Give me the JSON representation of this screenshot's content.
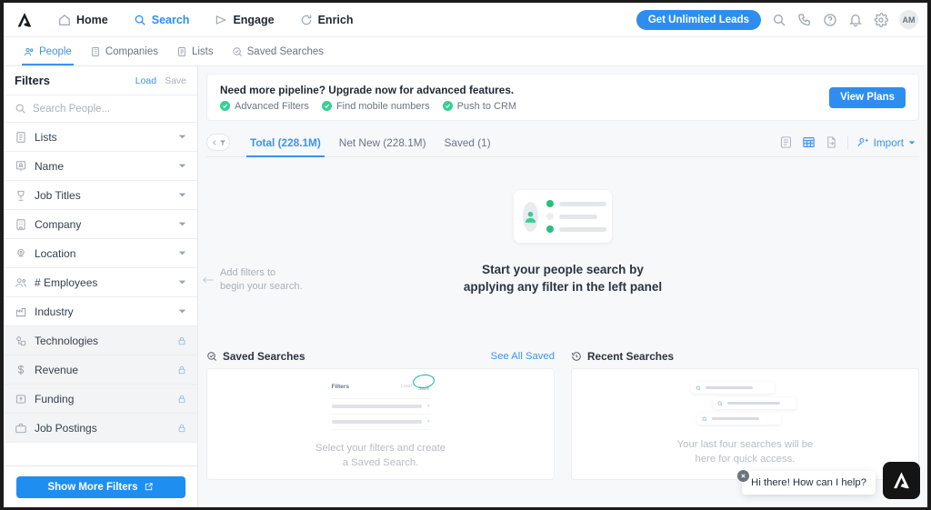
{
  "topnav": {
    "logo_name": "apollo-logo",
    "items": [
      {
        "label": "Home",
        "icon": "home-icon",
        "active": false
      },
      {
        "label": "Search",
        "icon": "search-icon",
        "active": true
      },
      {
        "label": "Engage",
        "icon": "send-icon",
        "active": false
      },
      {
        "label": "Enrich",
        "icon": "refresh-icon",
        "active": false
      }
    ],
    "cta_label": "Get Unlimited Leads",
    "icons": [
      "search-icon",
      "phone-icon",
      "help-circle-icon",
      "bell-icon",
      "gear-icon"
    ],
    "avatar_initials": "AM"
  },
  "subnav": {
    "items": [
      {
        "label": "People",
        "icon": "people-icon",
        "active": true
      },
      {
        "label": "Companies",
        "icon": "building-icon",
        "active": false
      },
      {
        "label": "Lists",
        "icon": "list-icon",
        "active": false
      },
      {
        "label": "Saved Searches",
        "icon": "saved-search-icon",
        "active": false
      }
    ]
  },
  "sidebar": {
    "title": "Filters",
    "load_label": "Load",
    "save_label": "Save",
    "search_placeholder": "Search People...",
    "filters": [
      {
        "label": "Lists",
        "icon": "list-icon",
        "locked": false
      },
      {
        "label": "Name",
        "icon": "badge-icon",
        "locked": false
      },
      {
        "label": "Job Titles",
        "icon": "job-icon",
        "locked": false
      },
      {
        "label": "Company",
        "icon": "building-icon",
        "locked": false
      },
      {
        "label": "Location",
        "icon": "pin-icon",
        "locked": false
      },
      {
        "label": "# Employees",
        "icon": "people-icon",
        "locked": false
      },
      {
        "label": "Industry",
        "icon": "industry-icon",
        "locked": false
      },
      {
        "label": "Technologies",
        "icon": "tech-icon",
        "locked": true
      },
      {
        "label": "Revenue",
        "icon": "dollar-icon",
        "locked": true
      },
      {
        "label": "Funding",
        "icon": "funding-icon",
        "locked": true
      },
      {
        "label": "Job Postings",
        "icon": "briefcase-icon",
        "locked": true
      }
    ],
    "show_more_label": "Show More Filters"
  },
  "banner": {
    "title": "Need more pipeline? Upgrade now for advanced features.",
    "features": [
      "Advanced Filters",
      "Find mobile numbers",
      "Push to CRM"
    ],
    "button_label": "View Plans"
  },
  "tabsbar": {
    "collapse_icon": "collapse-filter-icon",
    "tabs": [
      {
        "label": "Total (228.1M)",
        "active": true
      },
      {
        "label": "Net New (228.1M)",
        "active": false
      },
      {
        "label": "Saved (1)",
        "active": false
      }
    ],
    "view_icons": [
      {
        "name": "list-view-icon",
        "active": false
      },
      {
        "name": "table-view-icon",
        "active": true
      },
      {
        "name": "export-icon",
        "active": false
      }
    ],
    "import_label": "Import"
  },
  "empty_state": {
    "hint_line1": "Add filters to",
    "hint_line2": "begin your search.",
    "title_line1": "Start your people search by",
    "title_line2": "applying any filter in the left panel"
  },
  "cards": {
    "saved": {
      "title": "Saved Searches",
      "icon": "saved-search-icon",
      "link_label": "See All Saved",
      "caption_line1": "Select your filters and create",
      "caption_line2": "a Saved Search.",
      "mini": {
        "filters_label": "Filters",
        "load_label": "Load",
        "save_label": "Save"
      }
    },
    "recent": {
      "title": "Recent Searches",
      "icon": "history-icon",
      "caption_line1": "Your last four searches will be",
      "caption_line2": "here for quick access."
    }
  },
  "chat": {
    "message": "Hi there! How can I help?",
    "close_icon": "close-icon",
    "fab_icon": "apollo-logo"
  },
  "colors": {
    "accent_blue": "#2d8ef0",
    "link_blue": "#3b93ef",
    "green": "#37cf95",
    "teal": "#17b3a3",
    "page_bg": "#f7f8fa",
    "panel_bg": "#ffffff",
    "text_dark": "#1f2733",
    "text_muted": "#6b7480"
  }
}
